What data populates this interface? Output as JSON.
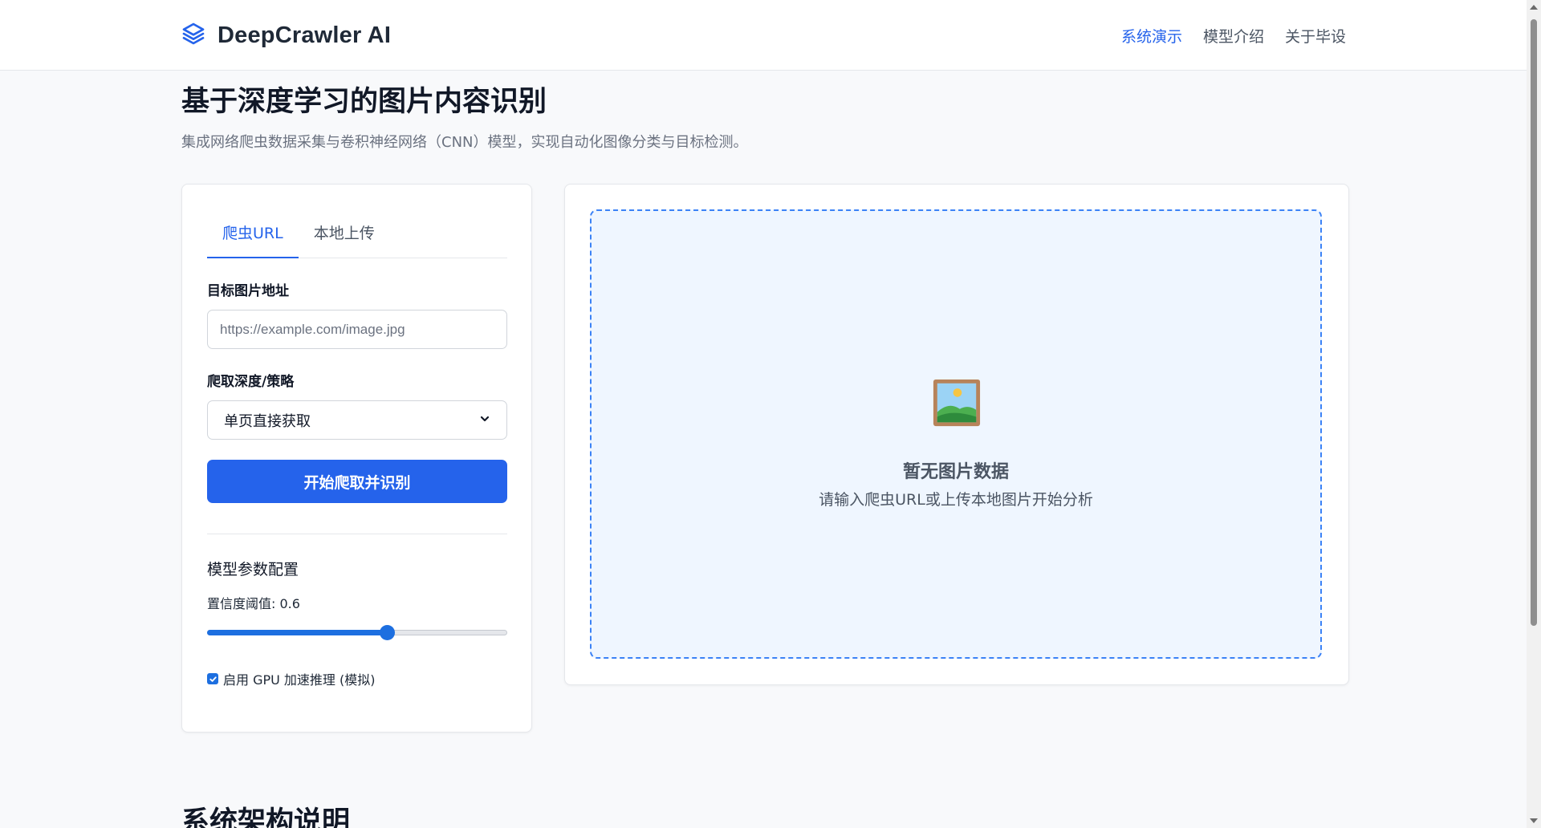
{
  "header": {
    "brand": "DeepCrawler AI",
    "brand_icon": "layers-icon",
    "nav": [
      {
        "label": "系统演示",
        "active": true
      },
      {
        "label": "模型介绍",
        "active": false
      },
      {
        "label": "关于毕设",
        "active": false
      }
    ]
  },
  "hero": {
    "title": "基于深度学习的图片内容识别",
    "subtitle": "集成网络爬虫数据采集与卷积神经网络（CNN）模型，实现自动化图像分类与目标检测。"
  },
  "panel": {
    "tabs": [
      {
        "label": "爬虫URL",
        "active": true
      },
      {
        "label": "本地上传",
        "active": false
      }
    ],
    "url_label": "目标图片地址",
    "url_placeholder": "https://example.com/image.jpg",
    "url_value": "",
    "strategy_label": "爬取深度/策略",
    "strategy_selected": "单页直接获取",
    "submit_label": "开始爬取并识别",
    "params_title": "模型参数配置",
    "confidence_label": "置信度阈值: 0.6",
    "confidence_value": 0.6,
    "gpu_label": "启用 GPU 加速推理 (模拟)",
    "gpu_checked": true
  },
  "preview": {
    "empty_icon": "framed-picture-icon",
    "empty_title": "暂无图片数据",
    "empty_desc": "请输入爬虫URL或上传本地图片开始分析"
  },
  "architecture": {
    "title": "系统架构说明"
  },
  "colors": {
    "accent": "#2563eb",
    "dropzone_border": "#3b82f6",
    "dropzone_bg": "#eff6ff"
  }
}
